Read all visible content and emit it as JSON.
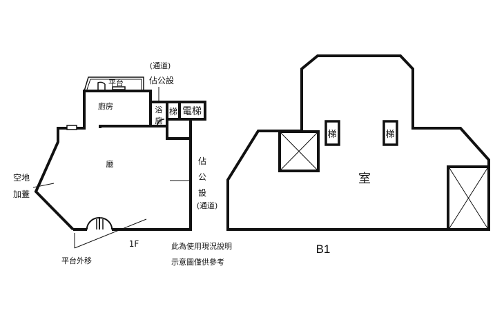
{
  "floor_1f": {
    "label": "1F",
    "rooms": {
      "platform": "平台",
      "kitchen": "廚房",
      "hall": "廳",
      "bath_1": "浴",
      "bath_2": "廁",
      "stair": "梯",
      "elevator": "電梯"
    },
    "notes": {
      "passage_top": "(通道)",
      "occupied_public_top": "佔公設",
      "occupied_public_right_1": "佔",
      "occupied_public_right_2": "公",
      "occupied_public_right_3": "設",
      "passage_right": "(通道)",
      "open_space_1": "空地",
      "open_space_2": "加蓋",
      "platform_moved": "平台外移"
    }
  },
  "floor_b1": {
    "label": "B1",
    "rooms": {
      "stair_left": "梯",
      "stair_right": "梯",
      "room": "室"
    }
  },
  "disclaimer": {
    "line_1": "此為使用現況說明",
    "line_2": "示意圖僅供參考"
  },
  "colors": {
    "background": "#ffffff",
    "line": "#111111"
  }
}
